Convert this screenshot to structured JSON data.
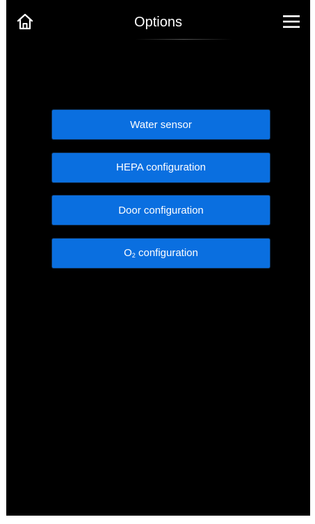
{
  "header": {
    "title": "Options"
  },
  "icons": {
    "home": "home-icon",
    "menu": "hamburger-menu-icon"
  },
  "colors": {
    "background": "#000000",
    "button": "#0a6fe0",
    "text": "#ffffff"
  },
  "options": {
    "water_sensor": "Water sensor",
    "hepa": "HEPA configuration",
    "door": "Door configuration",
    "o2_prefix": "O",
    "o2_subscript": "2",
    "o2_suffix": " configuration"
  }
}
